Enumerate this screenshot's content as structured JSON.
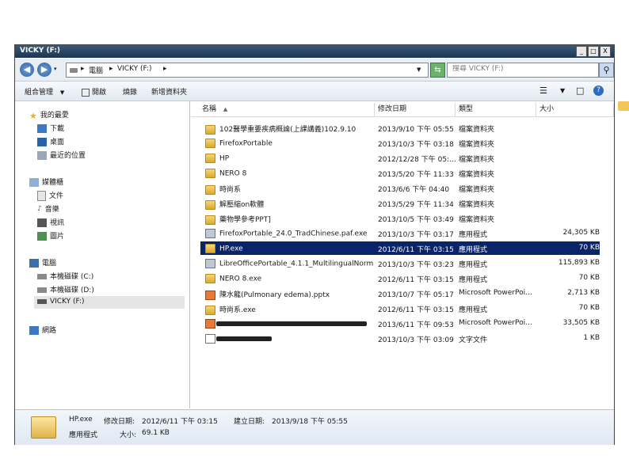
{
  "window": {
    "title": "VICKY (F:)",
    "min": "_",
    "max": "□",
    "close": "X"
  },
  "address": {
    "computer": "電腦",
    "drive": "VICKY (F:)",
    "search_placeholder": "搜尋 VICKY (F:)"
  },
  "toolbar": {
    "organize": "組合管理",
    "open": "開啟",
    "burn": "燒錄",
    "new_folder": "新增資料夾"
  },
  "sidebar": {
    "favorites": "我的最愛",
    "downloads": "下載",
    "desktop": "桌面",
    "recent": "最近的位置",
    "libraries": "媒體櫃",
    "documents": "文件",
    "music": "音樂",
    "videos": "視訊",
    "pictures": "圖片",
    "computer": "電腦",
    "disk_c": "本機磁碟 (C:)",
    "disk_d": "本機磁碟 (D:)",
    "vicky": "VICKY (F:)",
    "network": "網路"
  },
  "columns": {
    "name": "名稱",
    "modified": "修改日期",
    "type": "類型",
    "size": "大小"
  },
  "files": [
    {
      "name": "102醫學重要疾病概論(上課講義)102.9.10",
      "date": "2013/9/10 下午 05:55",
      "type": "檔案資料夾",
      "size": "",
      "icon": "folder-icon"
    },
    {
      "name": "FirefoxPortable",
      "date": "2013/10/3 下午 03:18",
      "type": "檔案資料夾",
      "size": "",
      "icon": "folder-icon"
    },
    {
      "name": "HP",
      "date": "2012/12/28 下午 05:…",
      "type": "檔案資料夾",
      "size": "",
      "icon": "folder-icon"
    },
    {
      "name": "NERO 8",
      "date": "2013/5/20 下午 11:33",
      "type": "檔案資料夾",
      "size": "",
      "icon": "folder-icon"
    },
    {
      "name": "時尚系",
      "date": "2013/6/6 下午 04:40",
      "type": "檔案資料夾",
      "size": "",
      "icon": "folder-icon"
    },
    {
      "name": "解壓縮on軟體",
      "date": "2013/5/29 下午 11:34",
      "type": "檔案資料夾",
      "size": "",
      "icon": "folder-icon"
    },
    {
      "name": "藥物學參考PPT]",
      "date": "2013/10/5 下午 03:49",
      "type": "檔案資料夾",
      "size": "",
      "icon": "folder-icon"
    },
    {
      "name": "FirefoxPortable_24.0_TradChinese.paf.exe",
      "date": "2013/10/3 下午 03:17",
      "type": "應用程式",
      "size": "24,305 KB",
      "icon": "exe-icon"
    },
    {
      "name": "HP.exe",
      "date": "2012/6/11 下午 03:15",
      "type": "應用程式",
      "size": "70 KB",
      "icon": "folder-icon",
      "selected": true
    },
    {
      "name": "LibreOfficePortable_4.1.1_MultilingualNorma…",
      "date": "2013/10/3 下午 03:23",
      "type": "應用程式",
      "size": "115,893 KB",
      "icon": "exe-icon"
    },
    {
      "name": "NERO 8.exe",
      "date": "2012/6/11 下午 03:15",
      "type": "應用程式",
      "size": "70 KB",
      "icon": "folder-icon"
    },
    {
      "name": "陳水龍(Pulmonary edema).pptx",
      "date": "2013/10/7 下午 05:17",
      "type": "Microsoft PowerPoi…",
      "size": "2,713 KB",
      "icon": "ppt-icon"
    },
    {
      "name": "時尚系.exe",
      "date": "2012/6/11 下午 03:15",
      "type": "應用程式",
      "size": "70 KB",
      "icon": "folder-icon"
    },
    {
      "name": "",
      "date": "2013/6/11 下午 09:53",
      "type": "Microsoft PowerPoi…",
      "size": "33,505 KB",
      "icon": "ppt-icon",
      "redacted": 190
    },
    {
      "name": "",
      "date": "2013/10/3 下午 03:09",
      "type": "文字文件",
      "size": "1 KB",
      "icon": "txt-icon",
      "redacted": 70
    }
  ],
  "status": {
    "filename": "HP.exe",
    "modified_label": "修改日期:",
    "modified_value": "2012/6/11 下午 03:15",
    "created_label": "建立日期:",
    "created_value": "2013/9/18 下午 05:55",
    "type": "應用程式",
    "size_label": "大小:",
    "size_value": "69.1 KB"
  }
}
